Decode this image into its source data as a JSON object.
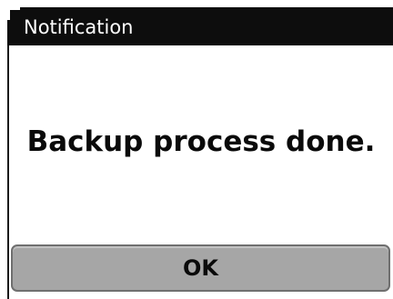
{
  "dialog": {
    "title": "Notification",
    "message": "Backup process done.",
    "ok_label": "OK"
  },
  "colors": {
    "titlebar": "#0d0d0d",
    "background": "#ffffff",
    "button": "#a6a6a6",
    "button_border": "#6f6f6f"
  }
}
